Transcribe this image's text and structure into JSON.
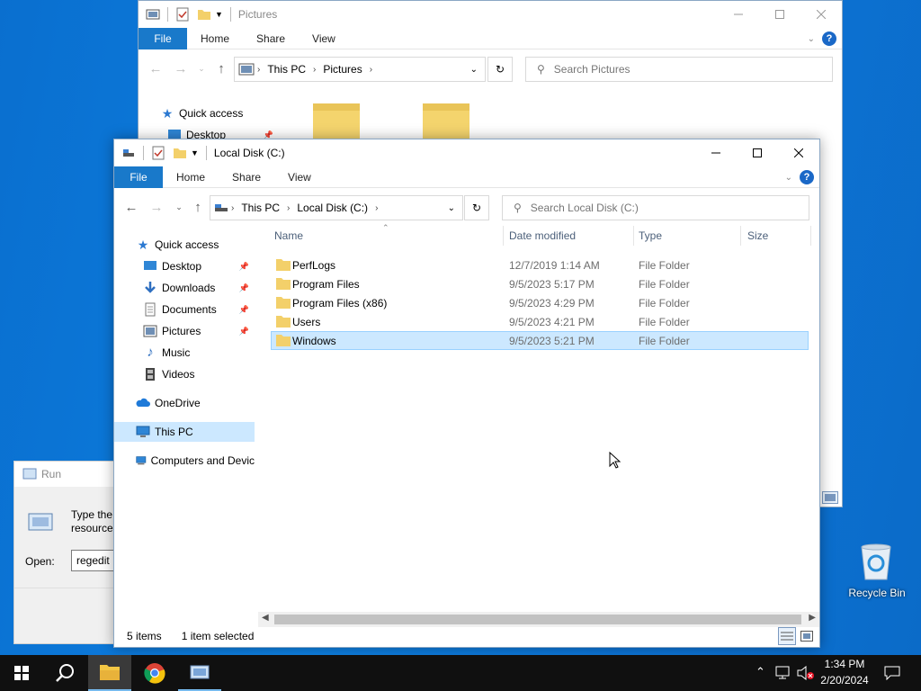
{
  "pictures_window": {
    "title": "Pictures",
    "tabs": {
      "file": "File",
      "home": "Home",
      "share": "Share",
      "view": "View"
    },
    "help_label": "?",
    "address": [
      "This PC",
      "Pictures"
    ],
    "search_placeholder": "Search Pictures",
    "nav": {
      "quick_access": "Quick access",
      "desktop": "Desktop"
    }
  },
  "explorer": {
    "title": "Local Disk (C:)",
    "tabs": {
      "file": "File",
      "home": "Home",
      "share": "Share",
      "view": "View"
    },
    "help_label": "?",
    "address": [
      "This PC",
      "Local Disk (C:)"
    ],
    "search_placeholder": "Search Local Disk (C:)",
    "nav": {
      "quick_access": "Quick access",
      "desktop": "Desktop",
      "downloads": "Downloads",
      "documents": "Documents",
      "pictures": "Pictures",
      "music": "Music",
      "videos": "Videos",
      "onedrive": "OneDrive",
      "this_pc": "This PC",
      "network": "Computers and Devic"
    },
    "columns": {
      "name": "Name",
      "date": "Date modified",
      "type": "Type",
      "size": "Size"
    },
    "files": [
      {
        "name": "PerfLogs",
        "date": "12/7/2019 1:14 AM",
        "type": "File Folder"
      },
      {
        "name": "Program Files",
        "date": "9/5/2023 5:17 PM",
        "type": "File Folder"
      },
      {
        "name": "Program Files (x86)",
        "date": "9/5/2023 4:29 PM",
        "type": "File Folder"
      },
      {
        "name": "Users",
        "date": "9/5/2023 4:21 PM",
        "type": "File Folder"
      },
      {
        "name": "Windows",
        "date": "9/5/2023 5:21 PM",
        "type": "File Folder"
      }
    ],
    "status": {
      "items": "5 items",
      "selected": "1 item selected"
    }
  },
  "run_dialog": {
    "title": "Run",
    "desc_line1": "Type the",
    "desc_line2": "resource,",
    "open_label": "Open:",
    "open_value": "regedit"
  },
  "desktop": {
    "recycle_bin": "Recycle Bin"
  },
  "taskbar": {
    "time": "1:34 PM",
    "date": "2/20/2024"
  }
}
